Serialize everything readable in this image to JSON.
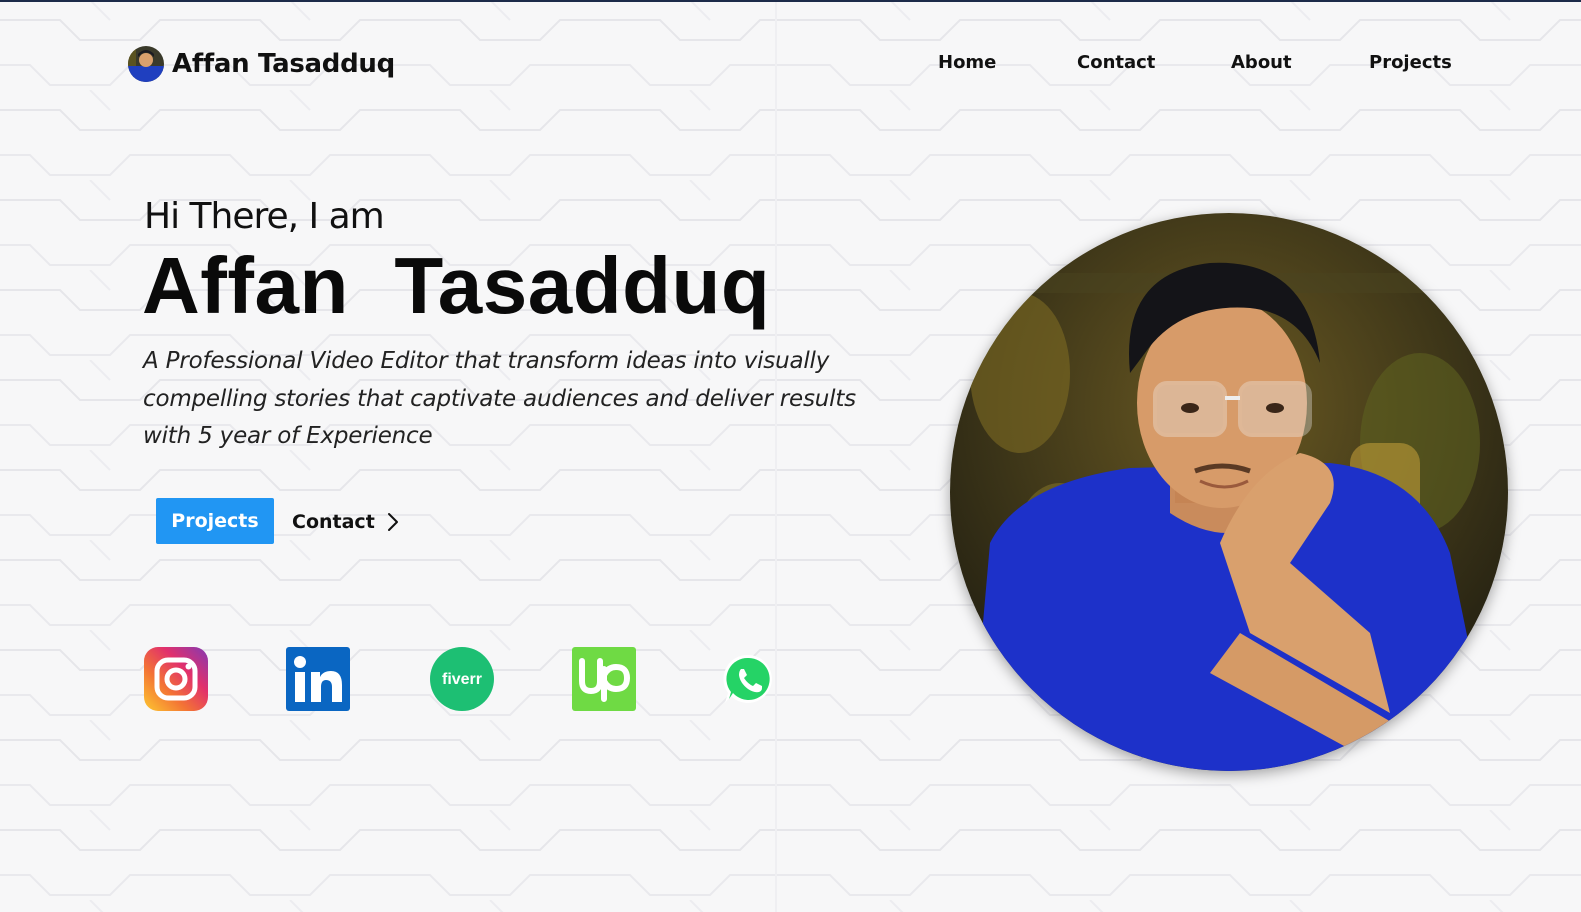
{
  "header": {
    "brand_name": "Affan Tasadduq",
    "nav": [
      "Home",
      "Contact",
      "About",
      "Projects"
    ]
  },
  "hero": {
    "greeting": "Hi There, I am",
    "name": "Affan  Tasadduq",
    "tagline": "A Professional Video Editor that transform ideas into visually compelling stories that captivate audiences and deliver results with 5 year of Experience",
    "primary_button": "Projects",
    "secondary_button": "Contact"
  },
  "social": {
    "fiverr_logo_text": "fiverr",
    "icons": [
      "instagram-icon",
      "linkedin-icon",
      "fiverr-icon",
      "upwork-icon",
      "whatsapp-icon"
    ]
  },
  "colors": {
    "accent": "#2196f3",
    "background": "#f7f7f8",
    "linkedin": "#0a66c2",
    "fiverr": "#1dbf73",
    "upwork": "#6fda44",
    "whatsapp": "#25d366"
  }
}
